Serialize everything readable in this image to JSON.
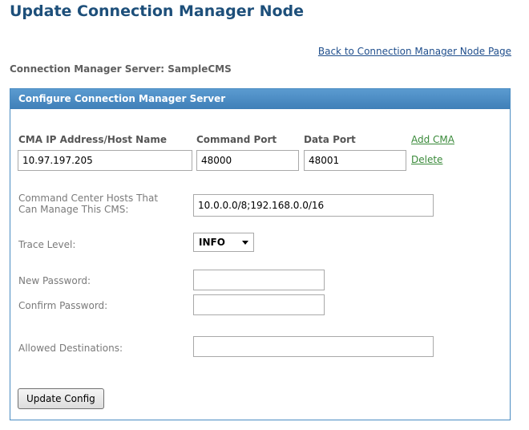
{
  "page": {
    "title": "Update Connection Manager Node",
    "back_link": "Back to Connection Manager Node Page",
    "server_label": "Connection Manager Server: SampleCMS"
  },
  "panel": {
    "title": "Configure Connection Manager Server",
    "columns": {
      "cma_ip": "CMA IP Address/Host Name",
      "command_port": "Command Port",
      "data_port": "Data Port"
    },
    "add_cma_link": "Add CMA",
    "delete_link": "Delete",
    "cma_row": {
      "ip": "10.97.197.205",
      "command_port": "48000",
      "data_port": "48001"
    },
    "hosts_label": "Command Center Hosts That Can Manage This CMS:",
    "hosts_value": "10.0.0.0/8;192.168.0.0/16",
    "trace_label": "Trace Level:",
    "trace_value": "INFO",
    "new_password_label": "New Password:",
    "new_password_value": "",
    "confirm_password_label": "Confirm Password:",
    "confirm_password_value": "",
    "allowed_destinations_label": "Allowed Destinations:",
    "allowed_destinations_value": "",
    "update_button": "Update Config"
  },
  "colors": {
    "title": "#1d4f7a",
    "panel_header": "#4a8cc2",
    "link_green": "#3a8a3a",
    "link_blue": "#1f4e8c"
  }
}
